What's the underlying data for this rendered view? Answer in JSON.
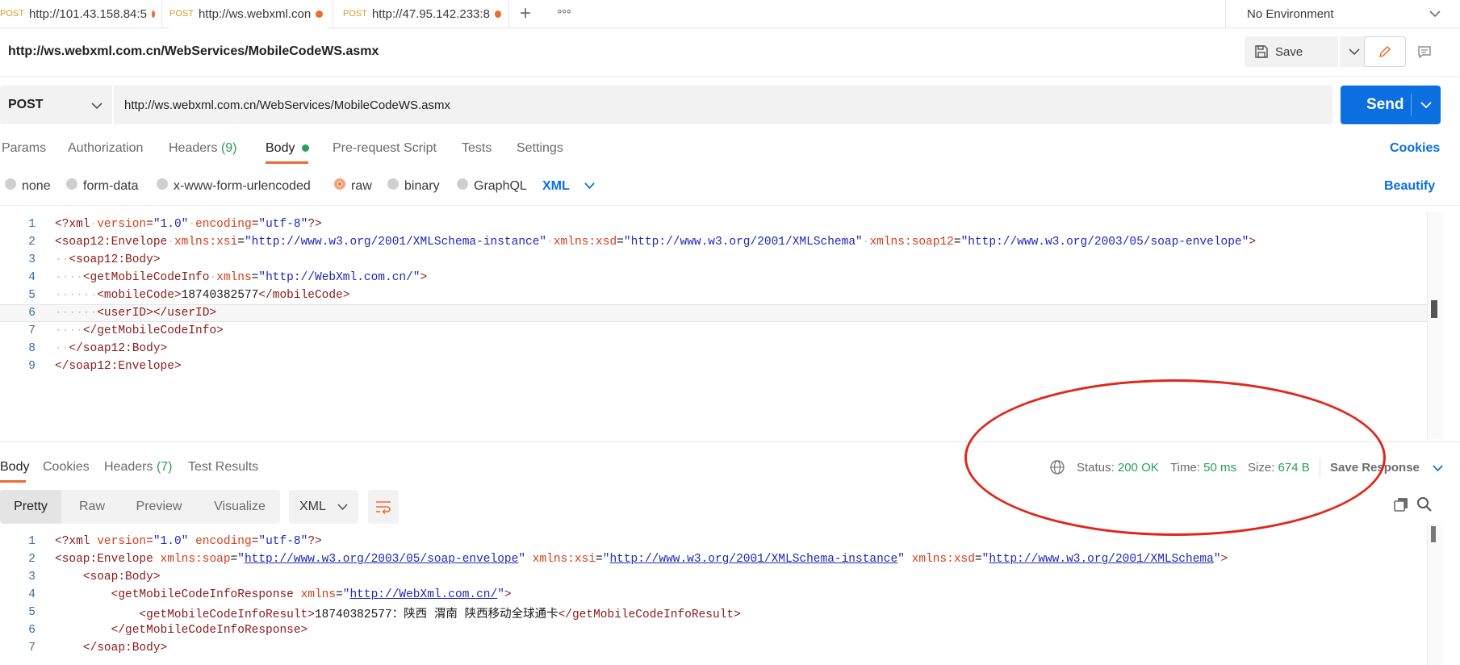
{
  "tabs": [
    {
      "method": "POST",
      "url": "http://101.43.158.84:5"
    },
    {
      "method": "POST",
      "url": "http://ws.webxml.con",
      "active": true
    },
    {
      "method": "POST",
      "url": "http://47.95.142.233:8"
    }
  ],
  "tab_actions": {
    "add": "+",
    "more": "∘∘∘"
  },
  "environment": {
    "label": "No Environment"
  },
  "request": {
    "name": "http://ws.webxml.com.cn/WebServices/MobileCodeWS.asmx",
    "save_label": "Save",
    "method": "POST",
    "url": "http://ws.webxml.com.cn/WebServices/MobileCodeWS.asmx",
    "send_label": "Send"
  },
  "request_tabs": {
    "params": "Params",
    "authorization": "Authorization",
    "headers": "Headers",
    "headers_count": "(9)",
    "body": "Body",
    "prerequest": "Pre-request Script",
    "tests": "Tests",
    "settings": "Settings",
    "cookies": "Cookies"
  },
  "body_types": {
    "none": "none",
    "form_data": "form-data",
    "urlencoded": "x-www-form-urlencoded",
    "raw": "raw",
    "binary": "binary",
    "graphql": "GraphQL",
    "language": "XML",
    "beautify": "Beautify",
    "selected": "raw"
  },
  "request_body_lines": [
    "<?xml version=\"1.0\" encoding=\"utf-8\"?>",
    "<soap12:Envelope xmlns:xsi=\"http://www.w3.org/2001/XMLSchema-instance\" xmlns:xsd=\"http://www.w3.org/2001/XMLSchema\" xmlns:soap12=\"http://www.w3.org/2003/05/soap-envelope\">",
    "  <soap12:Body>",
    "    <getMobileCodeInfo xmlns=\"http://WebXml.com.cn/\">",
    "      <mobileCode>18740382577</mobileCode>",
    "      <userID></userID>",
    "    </getMobileCodeInfo>",
    "  </soap12:Body>",
    "</soap12:Envelope>"
  ],
  "response": {
    "tabs": {
      "body": "Body",
      "cookies": "Cookies",
      "headers": "Headers",
      "headers_count": "(7)",
      "test_results": "Test Results"
    },
    "status_label": "Status:",
    "status": "200 OK",
    "time_label": "Time:",
    "time": "50 ms",
    "size_label": "Size:",
    "size": "674 B",
    "save_response": "Save Response",
    "formats": {
      "pretty": "Pretty",
      "raw": "Raw",
      "preview": "Preview",
      "visualize": "Visualize",
      "language": "XML"
    },
    "body_lines": [
      "<?xml version=\"1.0\" encoding=\"utf-8\"?>",
      "<soap:Envelope xmlns:soap=\"http://www.w3.org/2003/05/soap-envelope\" xmlns:xsi=\"http://www.w3.org/2001/XMLSchema-instance\" xmlns:xsd=\"http://www.w3.org/2001/XMLSchema\">",
      "    <soap:Body>",
      "        <getMobileCodeInfoResponse xmlns=\"http://WebXml.com.cn/\">",
      "            <getMobileCodeInfoResult>18740382577：陕西 渭南 陕西移动全球通卡</getMobileCodeInfoResult>",
      "        </getMobileCodeInfoResponse>",
      "    </soap:Body>"
    ]
  },
  "colors": {
    "accent": "#ef6a2e",
    "send": "#0b6fe0",
    "status_ok": "#27a05b",
    "annotation": "#e1261c"
  },
  "icons": [
    "save-icon",
    "chevron-down-icon",
    "pencil-icon",
    "comment-icon",
    "globe-icon",
    "wrap-lines-icon",
    "copy-icon",
    "search-icon"
  ]
}
